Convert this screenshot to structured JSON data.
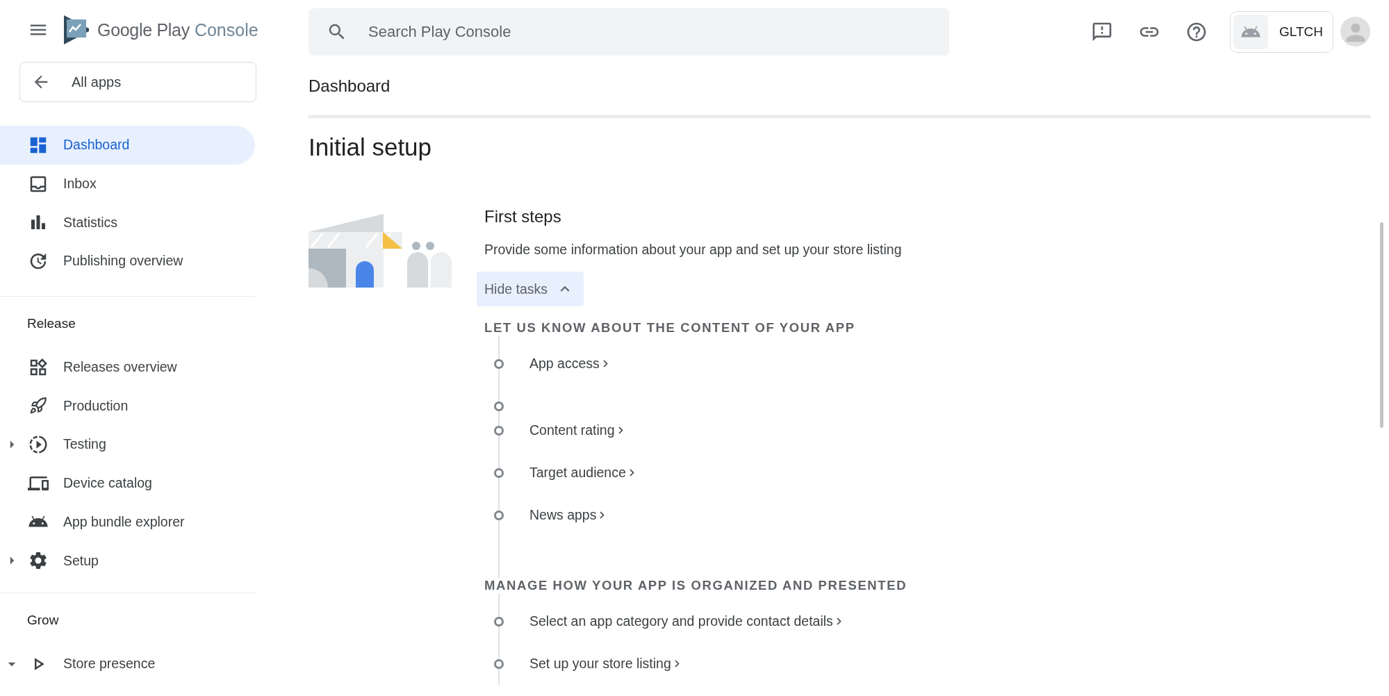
{
  "logo": {
    "brand": "Google Play",
    "product": "Console"
  },
  "back_button": {
    "label": "All apps"
  },
  "search": {
    "placeholder": "Search Play Console"
  },
  "app_chip": {
    "label": "GLTCH"
  },
  "sidebar": {
    "items": [
      {
        "label": "Dashboard",
        "selected": true
      },
      {
        "label": "Inbox",
        "selected": false
      },
      {
        "label": "Statistics",
        "selected": false
      },
      {
        "label": "Publishing overview",
        "selected": false
      }
    ],
    "sections": [
      {
        "title": "Release",
        "items": [
          {
            "label": "Releases overview",
            "selected": false
          },
          {
            "label": "Production",
            "selected": false
          },
          {
            "label": "Testing",
            "selected": false,
            "expanded": false
          },
          {
            "label": "Device catalog",
            "selected": false
          },
          {
            "label": "App bundle explorer",
            "selected": false
          },
          {
            "label": "Setup",
            "selected": false,
            "expanded": false
          }
        ]
      },
      {
        "title": "Grow",
        "items": [
          {
            "label": "Store presence",
            "selected": false,
            "expanded": true
          }
        ]
      }
    ]
  },
  "page_title": "Dashboard",
  "heading": "Initial setup",
  "card": {
    "title": "First steps",
    "description": "Provide some information about your app and set up your store listing",
    "toggle": {
      "label": "Hide tasks",
      "expanded": true
    },
    "groups": [
      {
        "title": "LET US KNOW ABOUT THE CONTENT OF YOUR APP",
        "tasks": [
          {
            "kind": "link",
            "label": "App access"
          },
          {
            "kind": "blank"
          },
          {
            "kind": "link",
            "label": "Content rating"
          },
          {
            "kind": "link",
            "label": "Target audience"
          },
          {
            "kind": "link",
            "label": "News apps"
          }
        ]
      },
      {
        "title": "MANAGE HOW YOUR APP IS ORGANIZED AND PRESENTED",
        "tasks": [
          {
            "kind": "link",
            "label": "Select an app category and provide contact details"
          },
          {
            "kind": "link",
            "label": "Set up your store listing"
          }
        ]
      }
    ]
  }
}
